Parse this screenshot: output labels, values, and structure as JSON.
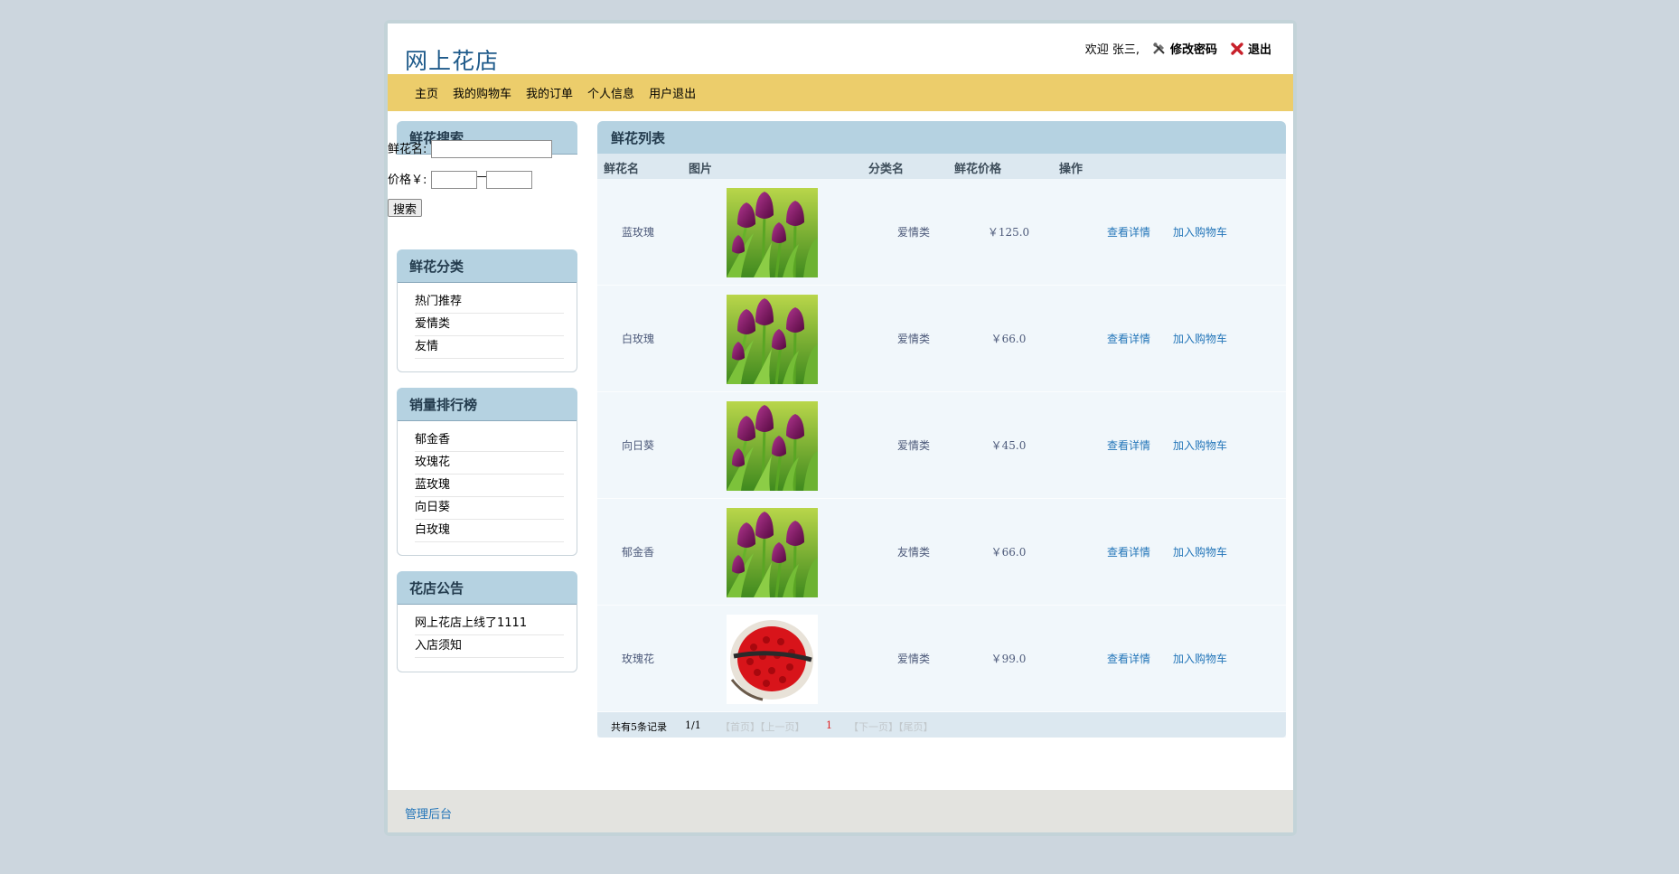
{
  "site": {
    "title": "网上花店"
  },
  "user_bar": {
    "welcome": "欢迎 张三,",
    "change_password": "修改密码",
    "logout": "退出"
  },
  "nav": [
    "主页",
    "我的购物车",
    "我的订单",
    "个人信息",
    "用户退出"
  ],
  "search": {
    "title": "鲜花搜索",
    "name_label": "鲜花名:",
    "name_value": "",
    "price_label": "价格￥:",
    "price_min": "",
    "price_sep": "—",
    "price_max": "",
    "button": "搜索"
  },
  "categories": {
    "title": "鲜花分类",
    "items": [
      "热门推荐",
      "爱情类",
      "友情"
    ]
  },
  "ranking": {
    "title": "销量排行榜",
    "items": [
      "郁金香",
      "玫瑰花",
      "蓝玫瑰",
      "向日葵",
      "白玫瑰"
    ]
  },
  "notices": {
    "title": "花店公告",
    "items": [
      "网上花店上线了1111",
      "入店须知"
    ]
  },
  "flower_list": {
    "title": "鲜花列表",
    "columns": {
      "name": "鲜花名",
      "image": "图片",
      "category": "分类名",
      "price": "鲜花价格",
      "action": "操作"
    },
    "rows": [
      {
        "name": "蓝玫瑰",
        "image": "tulip-photo",
        "category": "爱情类",
        "price": "￥125.0",
        "detail": "查看详情",
        "add_cart": "加入购物车"
      },
      {
        "name": "白玫瑰",
        "image": "tulip-photo",
        "category": "爱情类",
        "price": "￥66.0",
        "detail": "查看详情",
        "add_cart": "加入购物车"
      },
      {
        "name": "向日葵",
        "image": "tulip-photo",
        "category": "爱情类",
        "price": "￥45.0",
        "detail": "查看详情",
        "add_cart": "加入购物车"
      },
      {
        "name": "郁金香",
        "image": "tulip-photo",
        "category": "友情类",
        "price": "￥66.0",
        "detail": "查看详情",
        "add_cart": "加入购物车"
      },
      {
        "name": "玫瑰花",
        "image": "rose-bouquet-photo",
        "category": "爱情类",
        "price": "￥99.0",
        "detail": "查看详情",
        "add_cart": "加入购物车"
      }
    ],
    "pager": {
      "total": "共有5条记录",
      "page": "1/1",
      "first_prev": "【首页】【上一页】",
      "current": "1",
      "next_last": "【下一页】【尾页】"
    }
  },
  "footer": {
    "admin_link": "管理后台"
  },
  "colors": {
    "nav_bg": "#eccd6b",
    "panel_head": "#b5d2e1",
    "link": "#2476b9",
    "title": "#1e5a8a"
  }
}
